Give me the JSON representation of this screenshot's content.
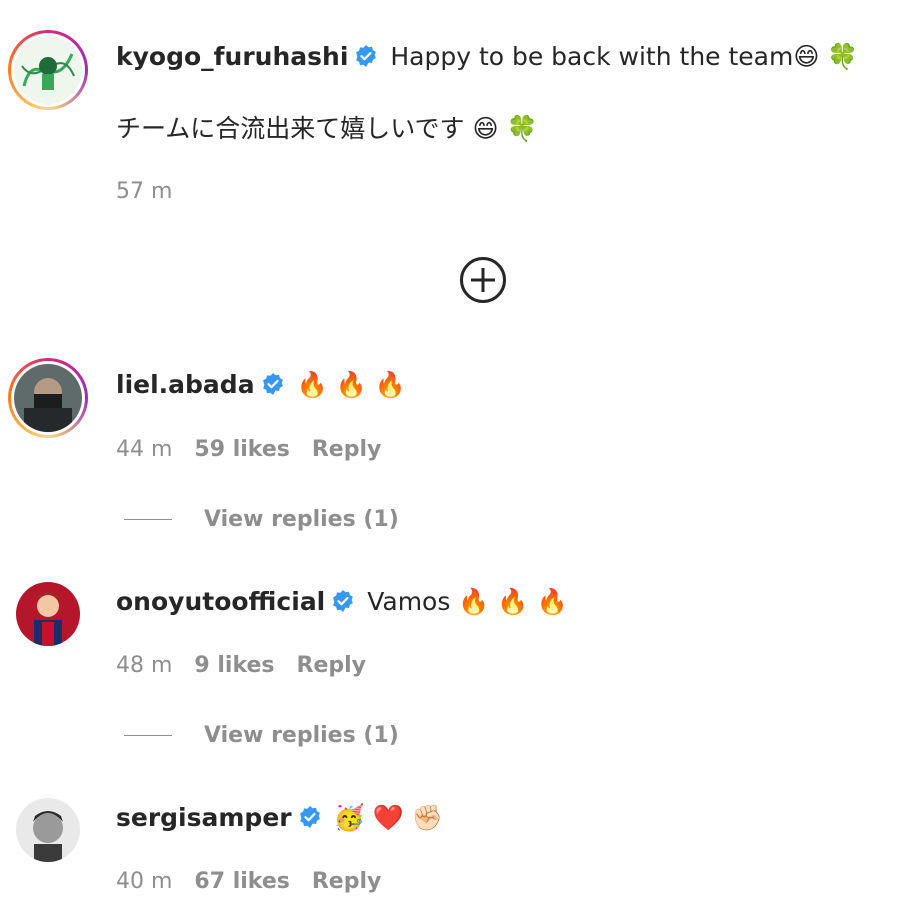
{
  "post": {
    "username": "kyogo_furuhashi",
    "caption_en": "Happy to be back with the team",
    "caption_en_emojis": "😄 🍀",
    "caption_jp": "チームに合流出来て嬉しいです",
    "caption_jp_emojis": "😄 🍀",
    "time": "57 m"
  },
  "comments": [
    {
      "username": "liel.abada",
      "text": "",
      "emojis": "🔥 🔥 🔥",
      "time": "44 m",
      "likes": "59 likes",
      "reply": "Reply",
      "view_replies": "View replies (1)"
    },
    {
      "username": "onoyutoofficial",
      "text": "Vamos",
      "emojis": "🔥 🔥 🔥",
      "time": "48 m",
      "likes": "9 likes",
      "reply": "Reply",
      "view_replies": "View replies (1)"
    },
    {
      "username": "sergisamper",
      "text": "",
      "emojis": "🥳 ❤️ ✊🏻",
      "time": "40 m",
      "likes": "67 likes",
      "reply": "Reply"
    }
  ],
  "colors": {
    "verified": "#3897f0",
    "secondary_text": "#8e8e8e",
    "primary_text": "#262626"
  }
}
